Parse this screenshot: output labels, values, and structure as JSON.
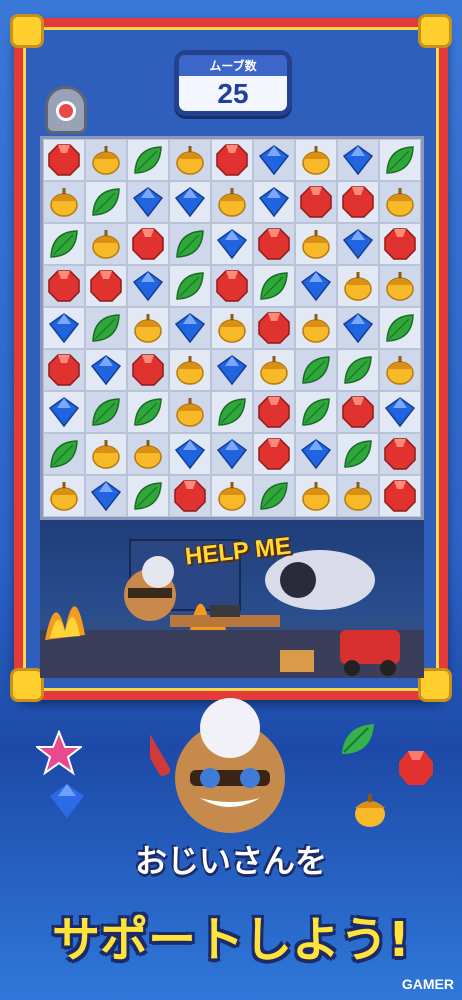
{
  "moves": {
    "label": "ムーブ数",
    "value": "25"
  },
  "board": [
    [
      "red",
      "yellow",
      "green",
      "yellow",
      "red",
      "blue",
      "yellow",
      "blue",
      "green"
    ],
    [
      "yellow",
      "green",
      "blue",
      "blue",
      "yellow",
      "blue",
      "red",
      "red",
      "yellow"
    ],
    [
      "green",
      "yellow",
      "red",
      "green",
      "blue",
      "red",
      "yellow",
      "blue",
      "red"
    ],
    [
      "red",
      "red",
      "blue",
      "green",
      "red",
      "green",
      "blue",
      "yellow",
      "yellow"
    ],
    [
      "blue",
      "green",
      "yellow",
      "blue",
      "yellow",
      "red",
      "yellow",
      "blue",
      "green"
    ],
    [
      "red",
      "blue",
      "red",
      "yellow",
      "blue",
      "yellow",
      "green",
      "green",
      "yellow"
    ],
    [
      "blue",
      "green",
      "green",
      "yellow",
      "green",
      "red",
      "green",
      "red",
      "blue"
    ],
    [
      "green",
      "yellow",
      "yellow",
      "blue",
      "blue",
      "red",
      "blue",
      "green",
      "red"
    ],
    [
      "yellow",
      "blue",
      "green",
      "red",
      "yellow",
      "green",
      "yellow",
      "yellow",
      "red"
    ]
  ],
  "scene": {
    "help_text": "HELP ME"
  },
  "tagline": {
    "line1": "おじいさんを",
    "line2": "サポートしよう!"
  },
  "watermark": "GAMER",
  "colors": {
    "red": "#e0332f",
    "yellow": "#f7b928",
    "green": "#2fa83a",
    "blue": "#2164e0",
    "frame": "#e43a3a",
    "accent": "#ffd84a"
  },
  "icons": {
    "red": "red-gem-icon",
    "yellow": "acorn-icon",
    "green": "leaf-icon",
    "blue": "blue-diamond-icon"
  }
}
